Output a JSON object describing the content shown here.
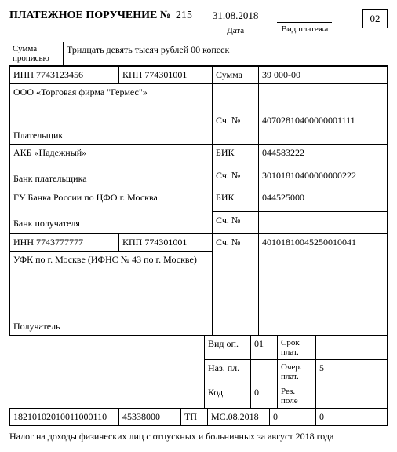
{
  "header": {
    "title": "ПЛАТЕЖНОЕ ПОРУЧЕНИЕ №",
    "number": "215",
    "date": "31.08.2018",
    "date_label": "Дата",
    "paytype_label": "Вид платежа",
    "form_code": "02"
  },
  "sum_words": {
    "label": "Сумма прописью",
    "value": "Тридцать девять тысяч рублей 00 копеек"
  },
  "payer": {
    "inn_label": "ИНН",
    "inn": "7743123456",
    "kpp_label": "КПП",
    "kpp": "774301001",
    "name": "ООО «Торговая фирма \"Гермес\"»",
    "label": "Плательщик",
    "sum_label": "Сумма",
    "sum": "39 000-00",
    "acc_label": "Сч. №",
    "acc": "40702810400000001111"
  },
  "payer_bank": {
    "name": "АКБ «Надежный»",
    "label": "Банк плательщика",
    "bik_label": "БИК",
    "bik": "044583222",
    "acc_label": "Сч. №",
    "acc": "30101810400000000222"
  },
  "recip_bank": {
    "name": "ГУ Банка России по ЦФО г. Москва",
    "label": "Банк получателя",
    "bik_label": "БИК",
    "bik": "044525000",
    "acc_label": "Сч. №",
    "acc": ""
  },
  "recipient": {
    "inn_label": "ИНН",
    "inn": "7743777777",
    "kpp_label": "КПП",
    "kpp": "774301001",
    "name": "УФК по г. Москве (ИФНС № 43 по г. Москве)",
    "label": "Получатель",
    "acc_label": "Сч. №",
    "acc": "40101810045250010041"
  },
  "codes": {
    "vid_op_label": "Вид оп.",
    "vid_op": "01",
    "srok_label": "Срок плат.",
    "srok": "",
    "naz_pl_label": "Наз. пл.",
    "naz_pl": "",
    "ocher_label": "Очер. плат.",
    "ocher": "5",
    "kod_label": "Код",
    "kod": "0",
    "rez_label": "Рез. поле",
    "rez": ""
  },
  "bottom": {
    "kbk": "18210102010011000110",
    "oktmo": "45338000",
    "tp": "ТП",
    "period": "МС.08.2018",
    "f1": "0",
    "f2": "0",
    "f3": ""
  },
  "purpose": "Налог на доходы физических лиц с отпускных и больничных за август 2018 года"
}
